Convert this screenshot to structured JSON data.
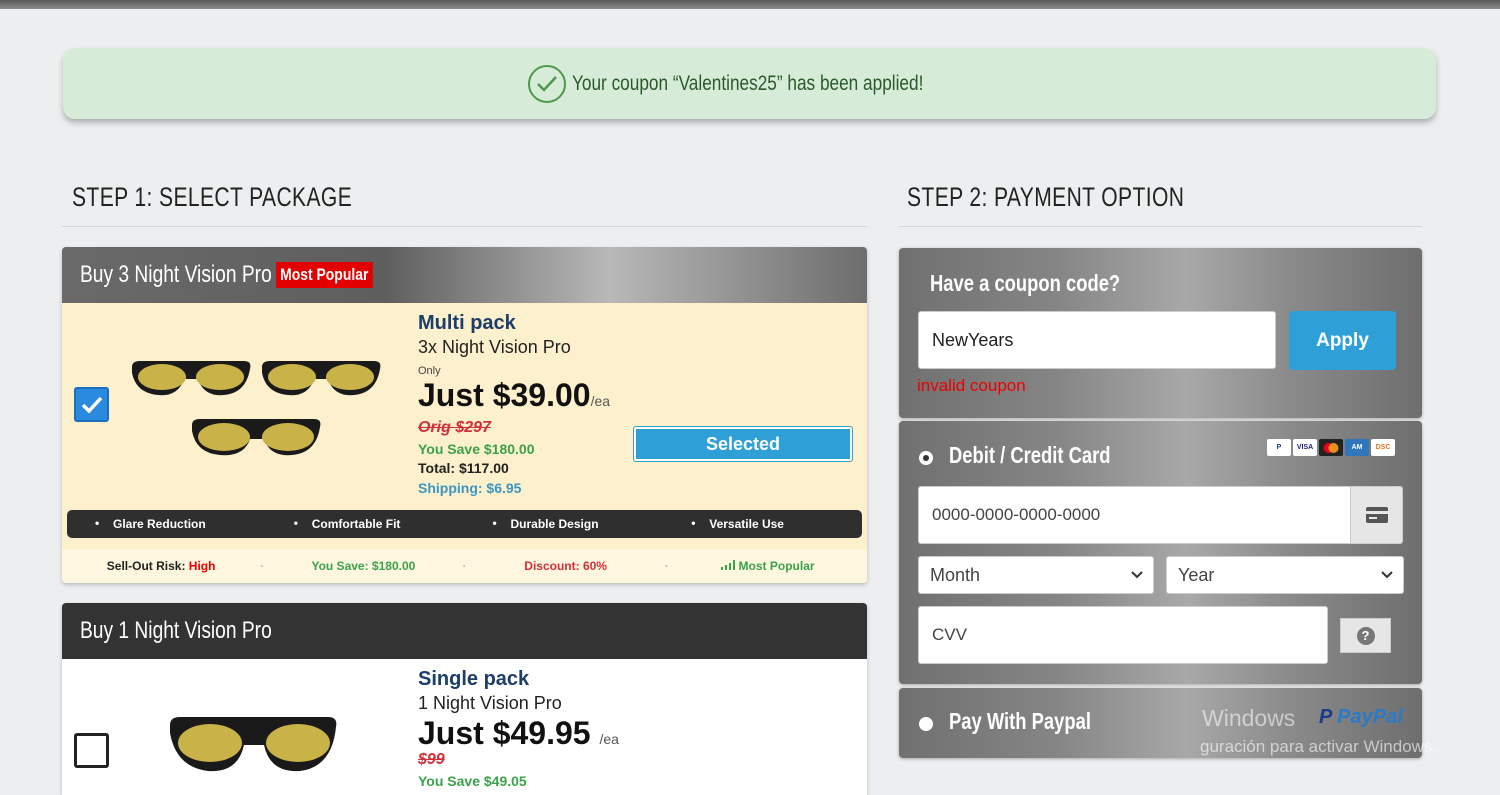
{
  "banner": {
    "text": "Your coupon “Valentines25” has been applied!"
  },
  "step1": {
    "title": "STEP 1: SELECT PACKAGE"
  },
  "step2": {
    "title": "STEP 2: PAYMENT OPTION"
  },
  "packages": [
    {
      "header": "Buy 3 Night Vision Pro",
      "badge": "Most Popular",
      "checked": true,
      "name": "Multi pack",
      "sub": "3x Night Vision Pro",
      "only": "Only",
      "price": "Just $39.00",
      "per": "/ea",
      "orig": "Orig $297",
      "save": "You Save $180.00",
      "total": "Total: $117.00",
      "shipping": "Shipping: $6.95",
      "button": "Selected",
      "features": [
        "Glare Reduction",
        "Comfortable Fit",
        "Durable Design",
        "Versatile Use"
      ],
      "stats": {
        "risk_label": "Sell-Out Risk:",
        "risk_value": "High",
        "save": "You Save: $180.00",
        "discount": "Discount: 60%",
        "popular": "Most Popular"
      }
    },
    {
      "header": "Buy 1 Night Vision Pro",
      "checked": false,
      "name": "Single pack",
      "sub": "1 Night Vision Pro",
      "price": "Just $49.95",
      "per": "/ea",
      "orig": "$99",
      "save": "You Save $49.05"
    }
  ],
  "coupon": {
    "title": "Have a coupon code?",
    "value": "NewYears",
    "apply": "Apply",
    "error": "invalid coupon"
  },
  "card": {
    "title": "Debit / Credit Card",
    "number_placeholder": "0000-0000-0000-0000",
    "month": "Month",
    "year": "Year",
    "cvv_placeholder": "CVV",
    "help": "?"
  },
  "paypal": {
    "title": "Pay With Paypal",
    "logo": "PayPal",
    "watermark_line1": "Windows",
    "watermark_line2": "guración para activar Windows."
  },
  "colors": {
    "accent": "#2f9fd8",
    "badge": "#e30000",
    "error": "#ee0000",
    "save": "#3aa24a"
  }
}
